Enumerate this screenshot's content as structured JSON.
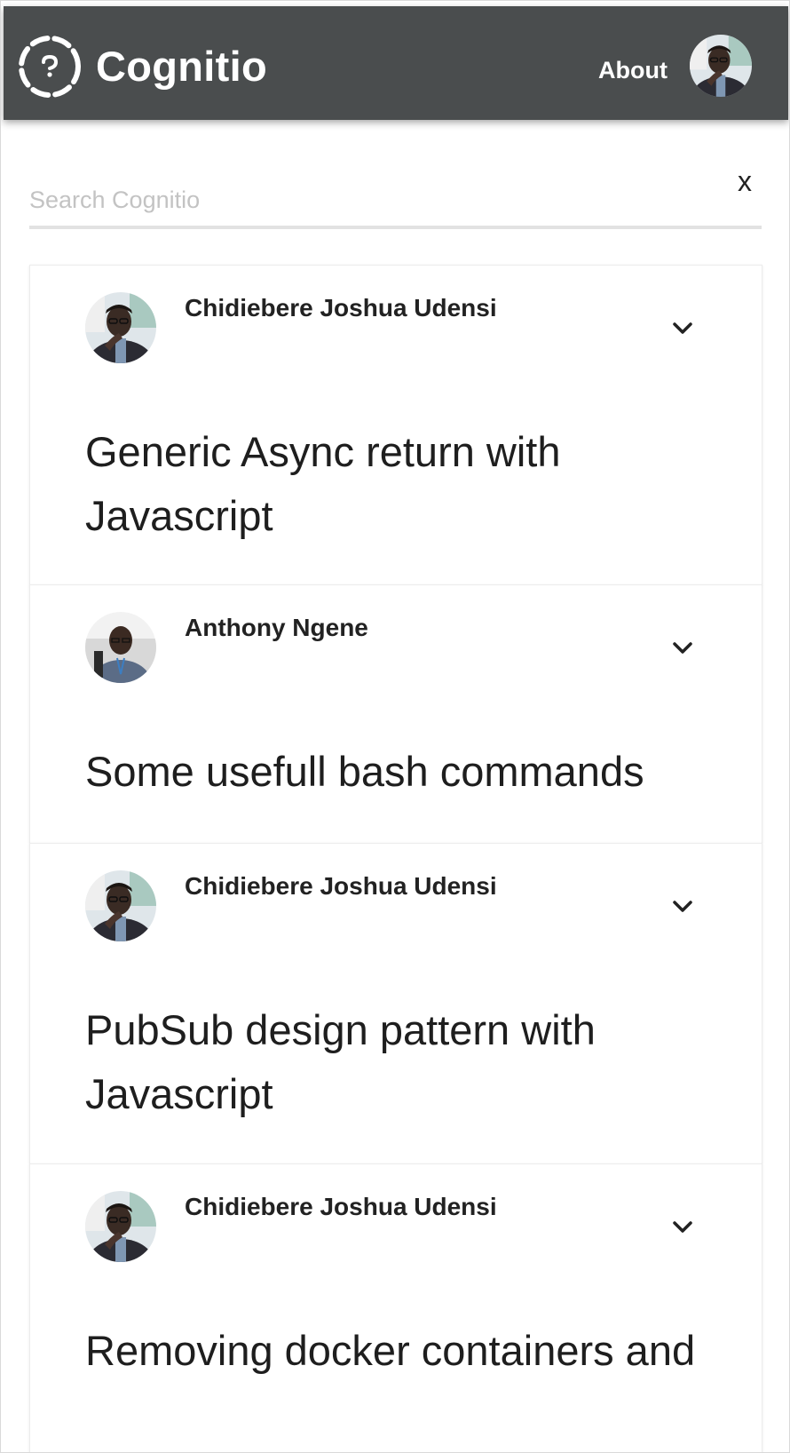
{
  "header": {
    "brand": "Cognitio",
    "about_label": "About",
    "logo_icon": "cognitio-logo-icon",
    "avatar_icon": "user-avatar"
  },
  "search": {
    "placeholder": "Search Cognitio",
    "value": "",
    "clear_label": "x"
  },
  "posts": [
    {
      "author": "Chidiebere Joshua Udensi",
      "title": "Generic Async return with Javascript",
      "avatar": "author-avatar-chidiebere"
    },
    {
      "author": "Anthony Ngene",
      "title": "Some usefull bash commands",
      "avatar": "author-avatar-anthony"
    },
    {
      "author": "Chidiebere Joshua Udensi",
      "title": "PubSub design pattern with Javascript",
      "avatar": "author-avatar-chidiebere"
    },
    {
      "author": "Chidiebere Joshua Udensi",
      "title": "Removing docker containers and",
      "avatar": "author-avatar-chidiebere"
    }
  ],
  "colors": {
    "header_bg": "#4a4d4e",
    "header_text": "#ffffff",
    "search_underline": "#e2e2e2",
    "title_text": "#1e1e1e"
  }
}
